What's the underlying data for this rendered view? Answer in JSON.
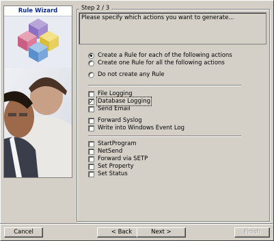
{
  "wizard": {
    "title": "Rule Wizard",
    "step_label": "Step 2 / 3",
    "instructions": "Please specify which actions you want to generate..."
  },
  "radio_options": [
    {
      "label": "Create a Rule for each of the following actions",
      "selected": true
    },
    {
      "label": "Create one Rule for all the following actions",
      "selected": false
    },
    {
      "label": "Do not create any Rule",
      "selected": false
    }
  ],
  "actions_group1": [
    {
      "label": "File Logging",
      "checked": false
    },
    {
      "label": "Database Logging",
      "checked": true
    },
    {
      "label": "Send Email",
      "checked": false
    }
  ],
  "actions_group2": [
    {
      "label": "Forward Syslog",
      "checked": false
    },
    {
      "label": "Write into Windows Event Log",
      "checked": false
    }
  ],
  "actions_group3": [
    {
      "label": "StartProgram",
      "checked": false
    },
    {
      "label": "NetSend",
      "checked": false
    },
    {
      "label": "Forward via SETP",
      "checked": false
    },
    {
      "label": "Set Property",
      "checked": false
    },
    {
      "label": "Set Status",
      "checked": false
    }
  ],
  "buttons": {
    "cancel": "Cancel",
    "back": "< Back",
    "next": "Next >",
    "finish": "Finish"
  },
  "colors": {
    "dialog_bg": "#d4d0c8",
    "title_text": "#0a2a8c"
  }
}
